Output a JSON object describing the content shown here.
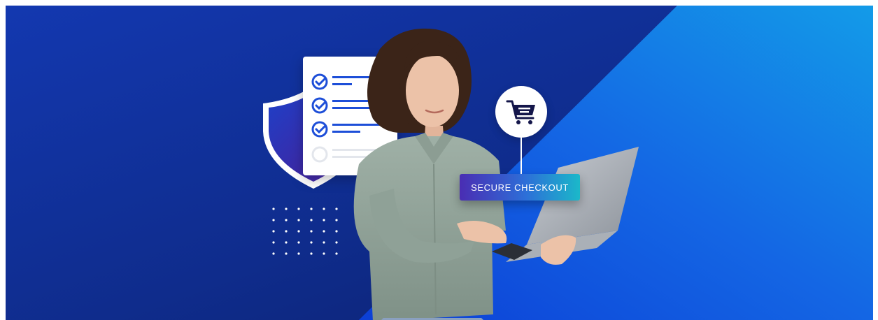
{
  "checkout_badge": {
    "label": "SECURE CHECKOUT"
  },
  "colors": {
    "bg_dark": "#0e2a86",
    "bg_light": "#1a8be6",
    "accent_blue": "#1d4ed8",
    "badge_start": "#4a2db3",
    "badge_end": "#1bb8c9"
  },
  "icons": [
    "shield-icon",
    "checkmark-icon",
    "shopping-cart-icon"
  ],
  "checklist": {
    "checked_items": 3,
    "total_items": 4
  }
}
